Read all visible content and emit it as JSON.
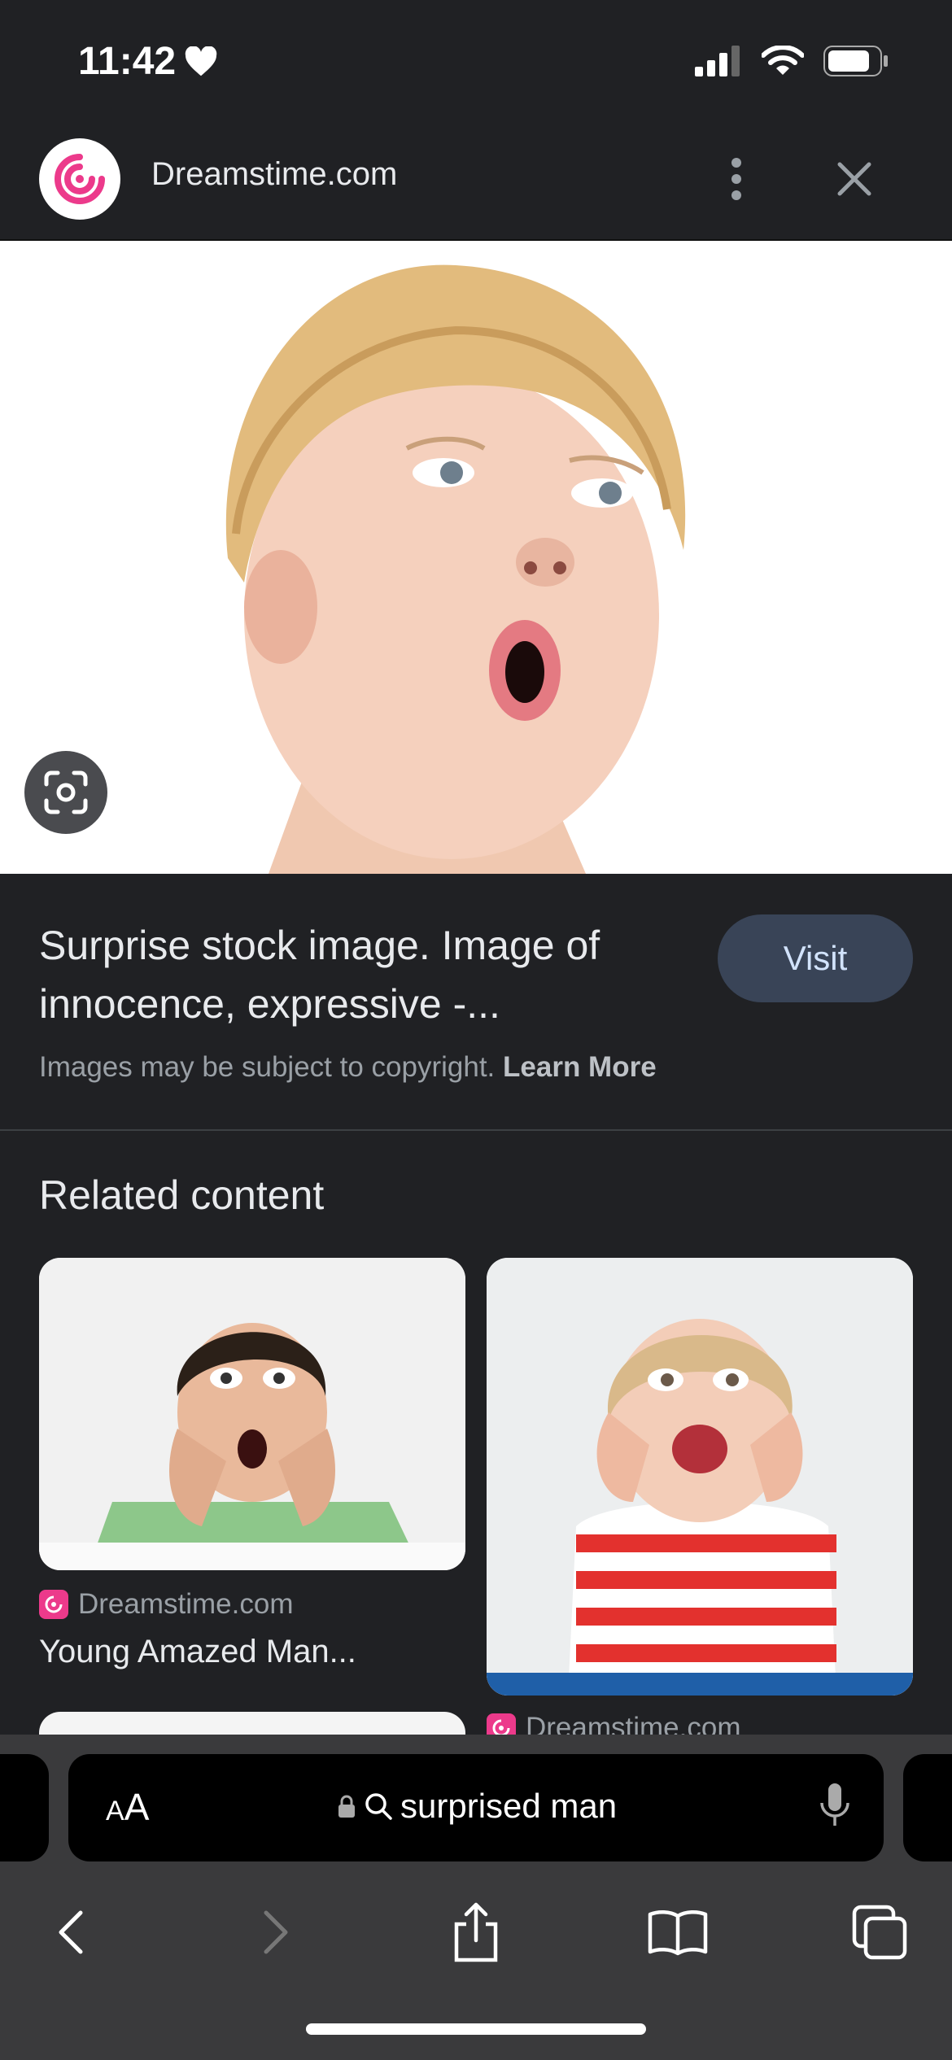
{
  "status": {
    "time": "11:42"
  },
  "header": {
    "site_name": "Dreamstime.com"
  },
  "result": {
    "title": "Surprise stock image. Image of innocence, expressive -...",
    "visit_label": "Visit",
    "copyright_text": "Images may be subject to copyright.",
    "learn_more": "Learn More"
  },
  "related": {
    "heading": "Related content",
    "cards": [
      {
        "source": "Dreamstime.com",
        "caption": "Young Amazed Man..."
      },
      {
        "source": "Dreamstime.com",
        "caption": ""
      }
    ]
  },
  "browser": {
    "text_size_label_small": "A",
    "text_size_label_large": "A",
    "query": "surprised man"
  },
  "colors": {
    "brand": "#ec3a8b",
    "visit_bg": "#394457",
    "background": "#202124"
  }
}
